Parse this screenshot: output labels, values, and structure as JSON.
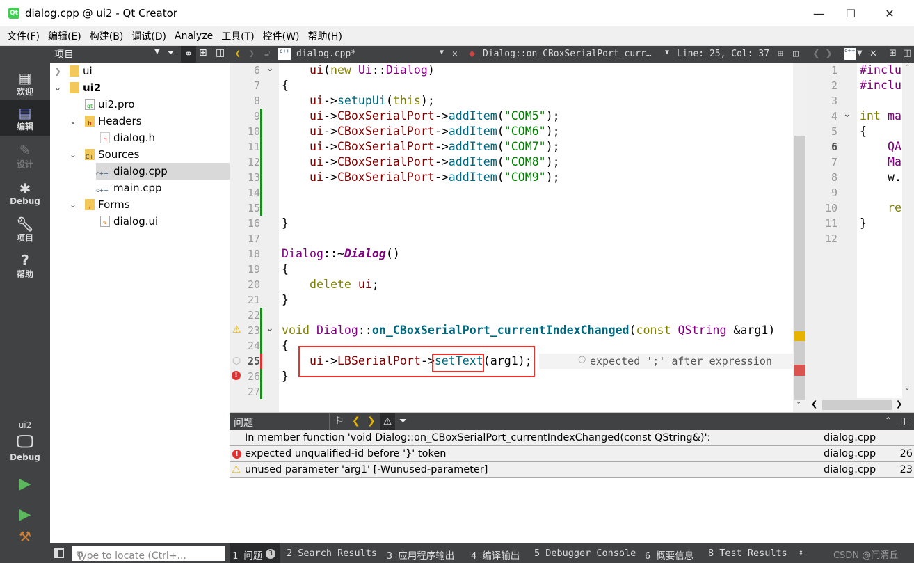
{
  "window": {
    "title": "dialog.cpp @ ui2 - Qt Creator",
    "qt_logo": "Qt",
    "minimize": "—",
    "maximize": "☐",
    "close": "✕"
  },
  "menu": [
    "文件(F)",
    "编辑(E)",
    "构建(B)",
    "调试(D)",
    "Analyze",
    "工具(T)",
    "控件(W)",
    "帮助(H)"
  ],
  "modes": [
    {
      "label": "欢迎",
      "icon": "grid-icon"
    },
    {
      "label": "编辑",
      "icon": "edit-icon"
    },
    {
      "label": "设计",
      "icon": "pencil-icon"
    },
    {
      "label": "Debug",
      "icon": "bug-icon"
    },
    {
      "label": "项目",
      "icon": "wrench-icon"
    },
    {
      "label": "帮助",
      "icon": "help-icon"
    }
  ],
  "kit": {
    "project": "ui2",
    "mode": "Debug"
  },
  "project_tree": {
    "title": "项目",
    "items": [
      {
        "label": "ui",
        "level": 0,
        "expanded": false
      },
      {
        "label": "ui2",
        "level": 0,
        "expanded": true
      },
      {
        "label": "ui2.pro",
        "level": 1
      },
      {
        "label": "Headers",
        "level": 1,
        "expanded": true
      },
      {
        "label": "dialog.h",
        "level": 2
      },
      {
        "label": "Sources",
        "level": 1,
        "expanded": true
      },
      {
        "label": "dialog.cpp",
        "level": 2,
        "selected": true
      },
      {
        "label": "main.cpp",
        "level": 2
      },
      {
        "label": "Forms",
        "level": 1,
        "expanded": true
      },
      {
        "label": "dialog.ui",
        "level": 2
      }
    ]
  },
  "editor": {
    "file": "dialog.cpp*",
    "symbol": "Dialog::on_CBoxSerialPort_curr…",
    "position": "Line: 25, Col: 37",
    "annotation": "expected ';' after expression",
    "lines": [
      {
        "n": 6,
        "seg": [
          [
            "d",
            "    "
          ],
          [
            "m",
            "ui"
          ],
          [
            "d",
            "("
          ],
          [
            "k",
            "new"
          ],
          [
            "d",
            " "
          ],
          [
            "ty",
            "Ui"
          ],
          [
            "d",
            "::"
          ],
          [
            "ty",
            "Dialog"
          ],
          [
            "d",
            ")"
          ]
        ]
      },
      {
        "n": 7,
        "seg": [
          [
            "d",
            "{"
          ]
        ]
      },
      {
        "n": 8,
        "seg": [
          [
            "d",
            "    "
          ],
          [
            "m",
            "ui"
          ],
          [
            "d",
            "->"
          ],
          [
            "f",
            "setupUi"
          ],
          [
            "d",
            "("
          ],
          [
            "k",
            "this"
          ],
          [
            "d",
            ");"
          ]
        ]
      },
      {
        "n": 9,
        "seg": [
          [
            "d",
            "    "
          ],
          [
            "m",
            "ui"
          ],
          [
            "d",
            "->"
          ],
          [
            "m",
            "CBoxSerialPort"
          ],
          [
            "d",
            "->"
          ],
          [
            "f",
            "addItem"
          ],
          [
            "d",
            "("
          ],
          [
            "s",
            "\"COM5\""
          ],
          [
            "d",
            ");"
          ]
        ]
      },
      {
        "n": 10,
        "seg": [
          [
            "d",
            "    "
          ],
          [
            "m",
            "ui"
          ],
          [
            "d",
            "->"
          ],
          [
            "m",
            "CBoxSerialPort"
          ],
          [
            "d",
            "->"
          ],
          [
            "f",
            "addItem"
          ],
          [
            "d",
            "("
          ],
          [
            "s",
            "\"COM6\""
          ],
          [
            "d",
            ");"
          ]
        ]
      },
      {
        "n": 11,
        "seg": [
          [
            "d",
            "    "
          ],
          [
            "m",
            "ui"
          ],
          [
            "d",
            "->"
          ],
          [
            "m",
            "CBoxSerialPort"
          ],
          [
            "d",
            "->"
          ],
          [
            "f",
            "addItem"
          ],
          [
            "d",
            "("
          ],
          [
            "s",
            "\"COM7\""
          ],
          [
            "d",
            ");"
          ]
        ]
      },
      {
        "n": 12,
        "seg": [
          [
            "d",
            "    "
          ],
          [
            "m",
            "ui"
          ],
          [
            "d",
            "->"
          ],
          [
            "m",
            "CBoxSerialPort"
          ],
          [
            "d",
            "->"
          ],
          [
            "f",
            "addItem"
          ],
          [
            "d",
            "("
          ],
          [
            "s",
            "\"COM8\""
          ],
          [
            "d",
            ");"
          ]
        ]
      },
      {
        "n": 13,
        "seg": [
          [
            "d",
            "    "
          ],
          [
            "m",
            "ui"
          ],
          [
            "d",
            "->"
          ],
          [
            "m",
            "CBoxSerialPort"
          ],
          [
            "d",
            "->"
          ],
          [
            "f",
            "addItem"
          ],
          [
            "d",
            "("
          ],
          [
            "s",
            "\"COM9\""
          ],
          [
            "d",
            ");"
          ]
        ]
      },
      {
        "n": 14,
        "seg": []
      },
      {
        "n": 15,
        "seg": []
      },
      {
        "n": 16,
        "seg": [
          [
            "d",
            "}"
          ]
        ]
      },
      {
        "n": 17,
        "seg": []
      },
      {
        "n": 18,
        "seg": [
          [
            "ty",
            "Dialog"
          ],
          [
            "d",
            "::~"
          ],
          [
            "it",
            "Dialog"
          ],
          [
            "d",
            "()"
          ]
        ]
      },
      {
        "n": 19,
        "seg": [
          [
            "d",
            "{"
          ]
        ]
      },
      {
        "n": 20,
        "seg": [
          [
            "d",
            "    "
          ],
          [
            "k",
            "delete"
          ],
          [
            "d",
            " "
          ],
          [
            "m",
            "ui"
          ],
          [
            "d",
            ";"
          ]
        ]
      },
      {
        "n": 21,
        "seg": [
          [
            "d",
            "}"
          ]
        ]
      },
      {
        "n": 22,
        "seg": []
      },
      {
        "n": 23,
        "seg": [
          [
            "k",
            "void"
          ],
          [
            "d",
            " "
          ],
          [
            "ty",
            "Dialog"
          ],
          [
            "d",
            "::"
          ],
          [
            "fn",
            "on_CBoxSerialPort_currentIndexChanged"
          ],
          [
            "d",
            "("
          ],
          [
            "k",
            "const"
          ],
          [
            "d",
            " "
          ],
          [
            "ty",
            "QString"
          ],
          [
            "d",
            " &arg1)"
          ]
        ]
      },
      {
        "n": 24,
        "seg": [
          [
            "d",
            "{"
          ]
        ]
      },
      {
        "n": 25,
        "seg": [
          [
            "d",
            "    "
          ],
          [
            "m",
            "ui"
          ],
          [
            "d",
            "->"
          ],
          [
            "m",
            "LBSerialPort"
          ],
          [
            "d",
            "->"
          ],
          [
            "f",
            "setText"
          ],
          [
            "d",
            "(arg1);"
          ]
        ]
      },
      {
        "n": 26,
        "seg": [
          [
            "d",
            "}"
          ]
        ]
      },
      {
        "n": 27,
        "seg": []
      }
    ]
  },
  "right_editor": {
    "lines": [
      {
        "n": 1,
        "seg": [
          [
            "ty",
            "#inclu"
          ]
        ]
      },
      {
        "n": 2,
        "seg": [
          [
            "ty",
            "#inclu"
          ]
        ]
      },
      {
        "n": 3,
        "seg": []
      },
      {
        "n": 4,
        "seg": [
          [
            "k",
            "int"
          ],
          [
            "d",
            " "
          ],
          [
            "ty",
            "ma"
          ]
        ]
      },
      {
        "n": 5,
        "seg": [
          [
            "d",
            "{"
          ]
        ]
      },
      {
        "n": 6,
        "seg": [
          [
            "d",
            "    "
          ],
          [
            "ty",
            "QA"
          ]
        ]
      },
      {
        "n": 7,
        "seg": [
          [
            "d",
            "    "
          ],
          [
            "ty",
            "Ma"
          ]
        ]
      },
      {
        "n": 8,
        "seg": [
          [
            "d",
            "    w."
          ]
        ]
      },
      {
        "n": 9,
        "seg": []
      },
      {
        "n": 10,
        "seg": [
          [
            "d",
            "    "
          ],
          [
            "k",
            "re"
          ]
        ]
      },
      {
        "n": 11,
        "seg": [
          [
            "d",
            "}"
          ]
        ]
      },
      {
        "n": 12,
        "seg": []
      }
    ]
  },
  "issues": {
    "title": "问题",
    "rows": [
      {
        "type": "info",
        "text": "In member function 'void Dialog::on_CBoxSerialPort_currentIndexChanged(const QString&)':",
        "file": "dialog.cpp",
        "line": ""
      },
      {
        "type": "error",
        "text": "expected unqualified-id before '}' token",
        "file": "dialog.cpp",
        "line": "26"
      },
      {
        "type": "warning",
        "text": "unused parameter 'arg1' [-Wunused-parameter]",
        "file": "dialog.cpp",
        "line": "23"
      }
    ]
  },
  "statusbar": {
    "locate_placeholder": "Type to locate (Ctrl+...",
    "tabs": [
      "1 问题",
      "2 Search Results",
      "3 应用程序输出",
      "4 编译输出",
      "5 Debugger Console",
      "6 概要信息",
      "8 Test Results"
    ],
    "issues_count": "3",
    "watermark": "CSDN @闫渭丘"
  },
  "colors": {
    "dark_panel": "#404244",
    "error": "#e03030",
    "warning": "#e6b400",
    "annotation_box": "#f0302a"
  }
}
